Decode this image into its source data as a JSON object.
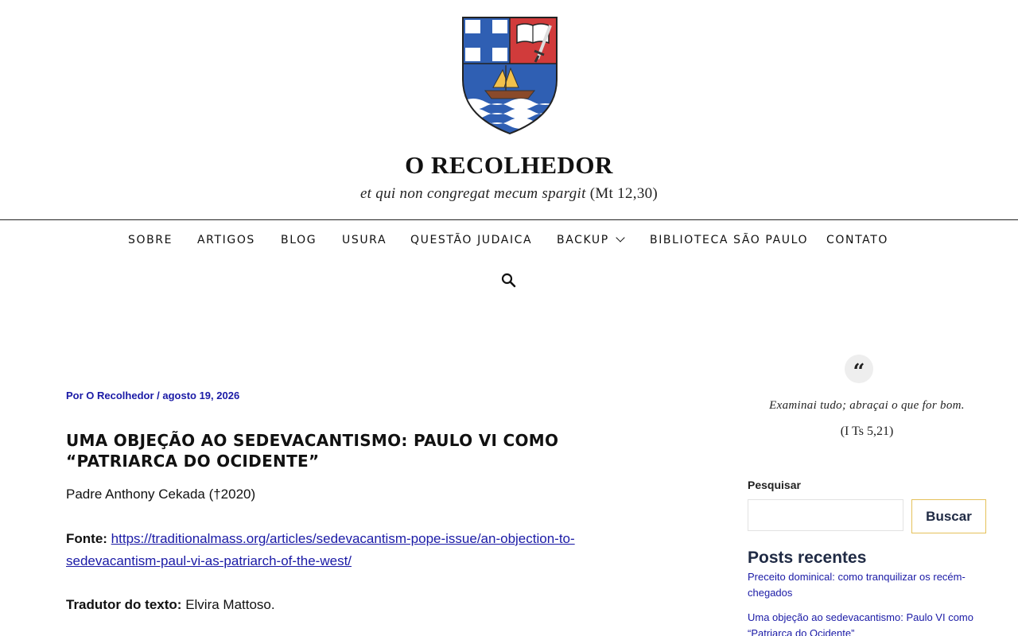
{
  "site": {
    "title": "O RECOLHEDOR",
    "tagline_italic": "et qui non congregat mecum spargit",
    "tagline_ref": "(Mt 12,30)"
  },
  "nav": {
    "items": [
      {
        "label": "SOBRE"
      },
      {
        "label": "ARTIGOS"
      },
      {
        "label": "BLOG"
      },
      {
        "label": "USURA"
      },
      {
        "label": "QUESTÃO JUDAICA"
      },
      {
        "label": "BACKUP"
      },
      {
        "label": "BIBLIOTECA SÃO PAULO"
      },
      {
        "label": "CONTATO"
      }
    ]
  },
  "post": {
    "meta": "Por O Recolhedor / agosto 19, 2026",
    "title": "UMA OBJEÇÃO AO SEDEVACANTISMO: PAULO VI COMO “PATRIARCA DO OCIDENTE”",
    "author_line": "Padre Anthony Cekada (†2020)",
    "source_label": "Fonte:",
    "source_url_line1": "https://traditionalmass.org/articles/sedevacantism-pope-issue/an-objection-to-",
    "source_url_line2": "sedevacantism-paul-vi-as-patriarch-of-the-west/",
    "translator_label": "Tradutor do texto:",
    "translator_name": "Elvira Mattoso."
  },
  "sidebar": {
    "quote_mark": "“",
    "quote": "Examinai tudo; abraçai o que for bom.",
    "quote_ref": "(I Ts 5,21)",
    "search_label": "Pesquisar",
    "search_value": "",
    "search_button": "Buscar",
    "recent_title": "Posts recentes",
    "recent_posts": [
      {
        "line1": "Preceito dominical: como tranquilizar os recém-",
        "line2": "chegados"
      },
      {
        "line1": "Uma objeção ao sedevacantismo: Paulo VI como",
        "line2": "“Patriarca do Ocidente”"
      }
    ]
  },
  "colors": {
    "link": "#1a1aa6",
    "shield_blue": "#2f5fb3",
    "shield_red": "#d13b3b",
    "button_border": "#e5c15a",
    "heading_dark": "#1f2a44"
  },
  "icons": [
    "coat-of-arms-logo",
    "search-icon",
    "chevron-down-icon",
    "quote-icon"
  ]
}
